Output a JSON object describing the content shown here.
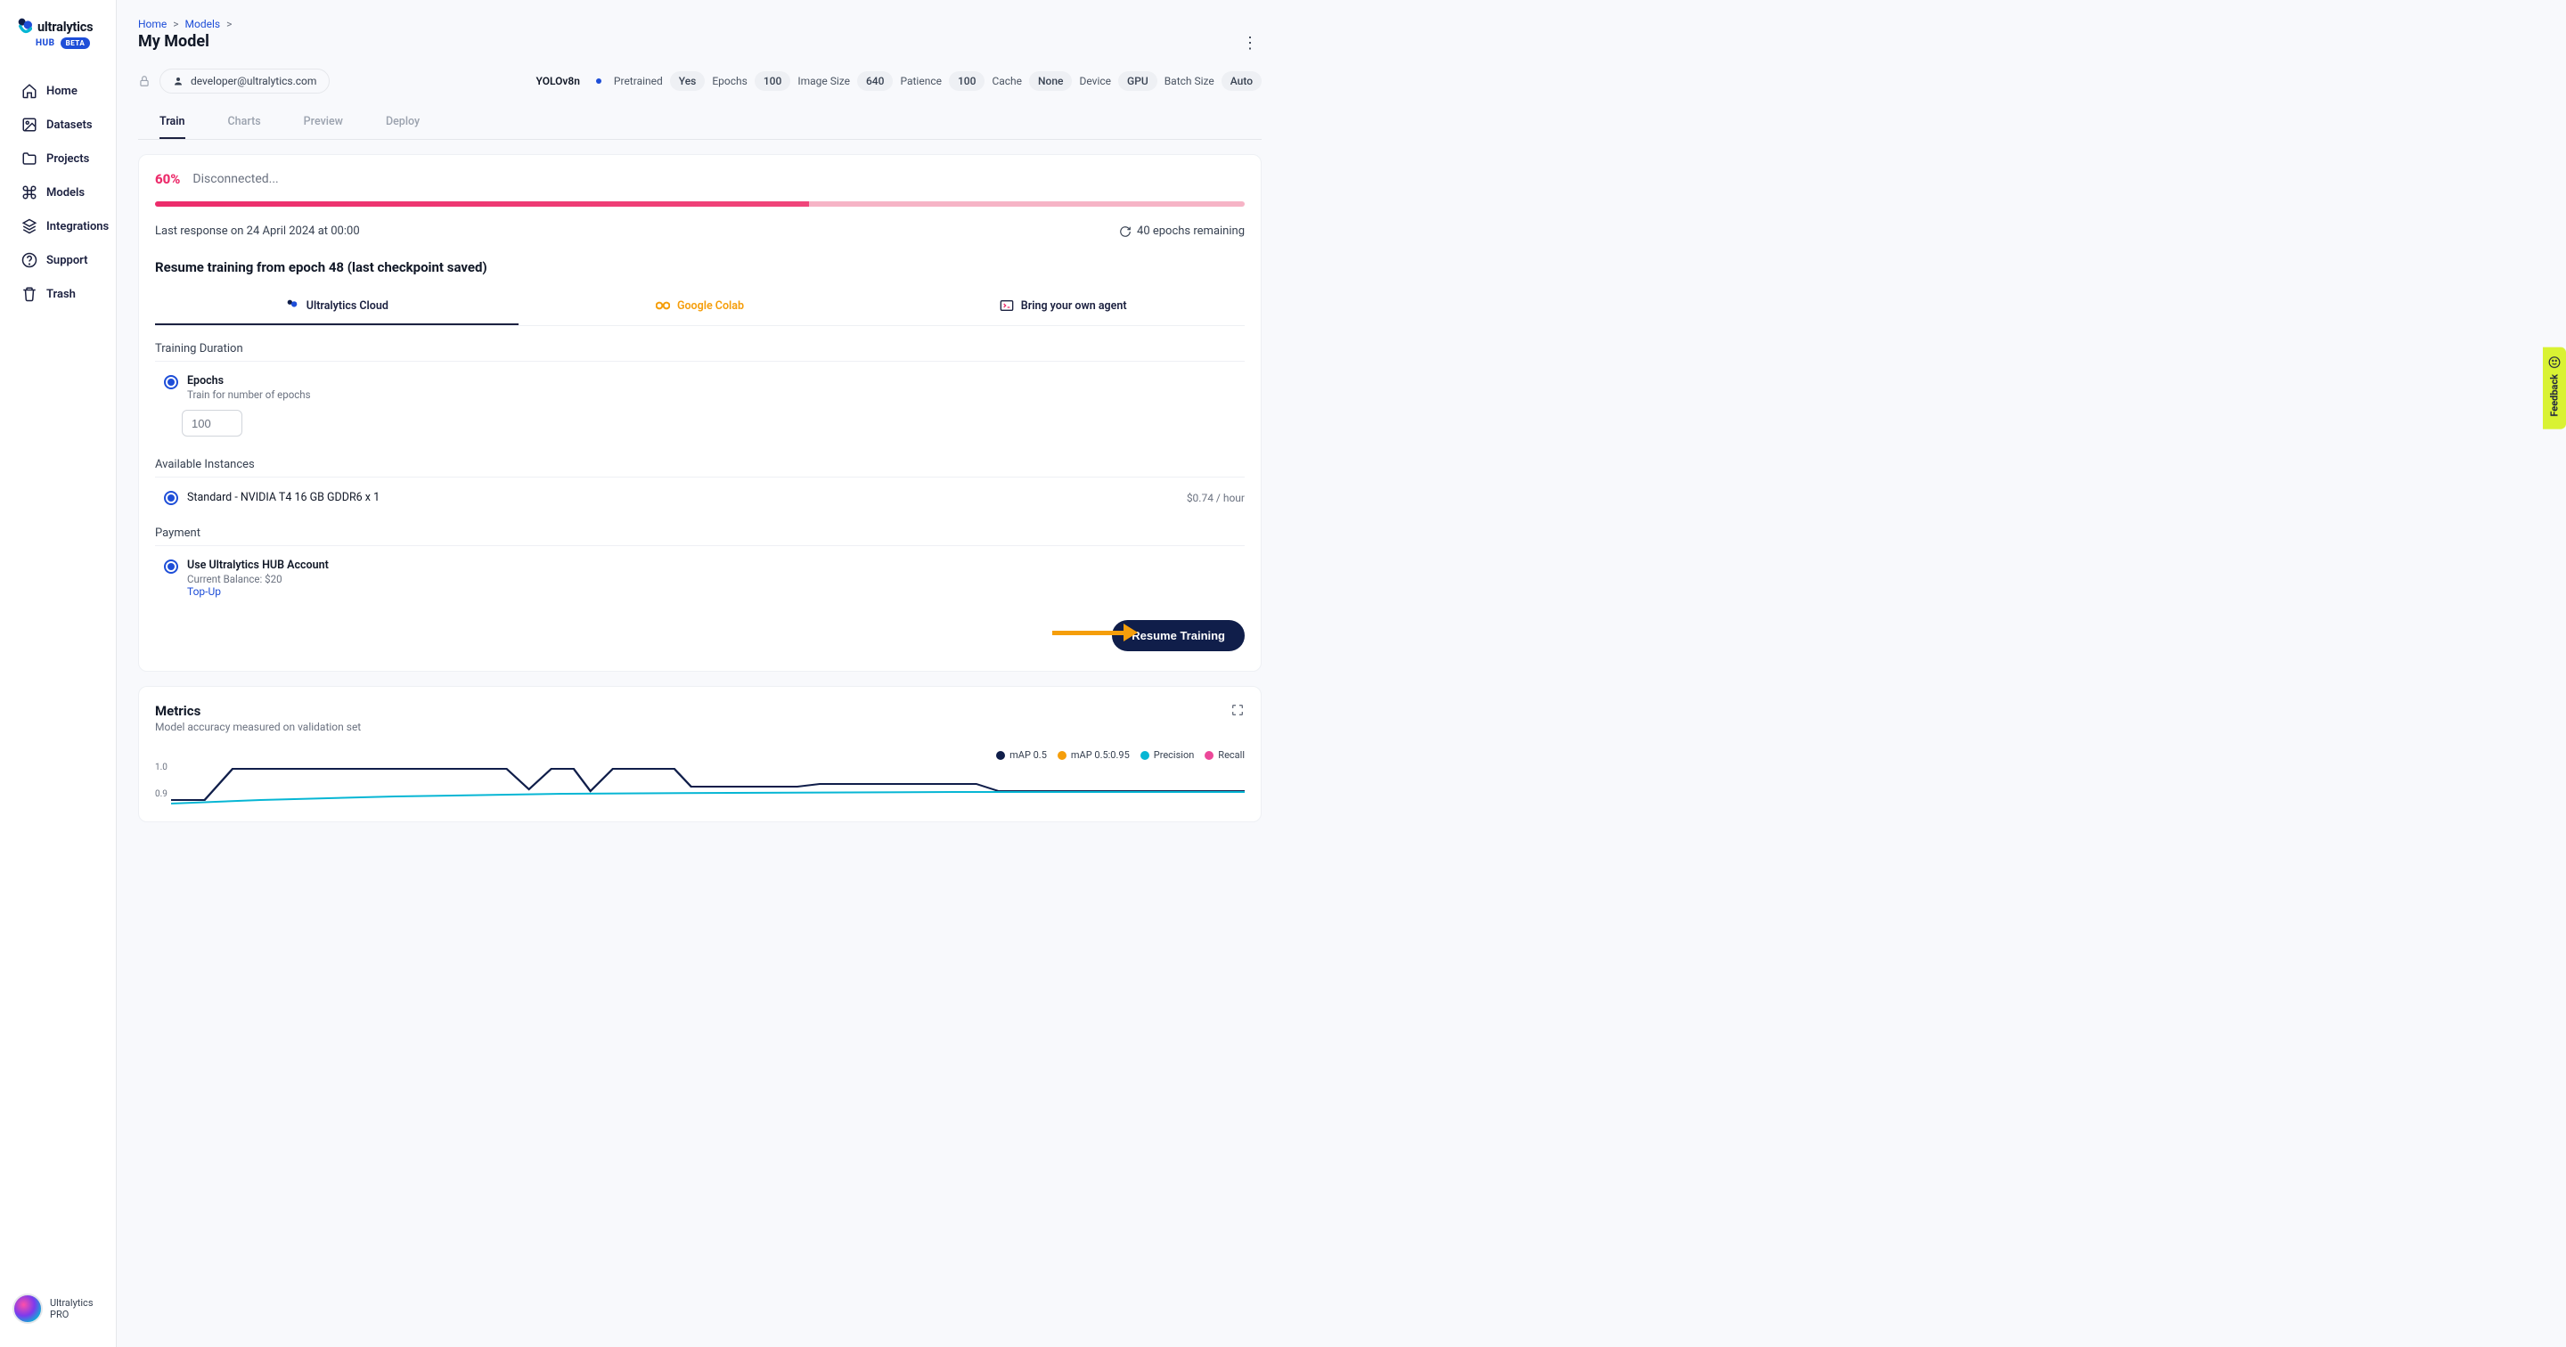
{
  "logo": {
    "brand": "ultralytics",
    "hub": "HUB",
    "beta": "BETA"
  },
  "sidebar": {
    "items": [
      {
        "label": "Home"
      },
      {
        "label": "Datasets"
      },
      {
        "label": "Projects"
      },
      {
        "label": "Models"
      },
      {
        "label": "Integrations"
      },
      {
        "label": "Support"
      },
      {
        "label": "Trash"
      }
    ],
    "user": {
      "name": "Ultralytics",
      "plan": "PRO"
    }
  },
  "breadcrumbs": {
    "home": "Home",
    "models": "Models"
  },
  "page_title": "My Model",
  "owner_email": "developer@ultralytics.com",
  "model_meta": {
    "model": "YOLOv8n",
    "pretrained_label": "Pretrained",
    "pretrained_val": "Yes",
    "epochs_label": "Epochs",
    "epochs_val": "100",
    "imgsz_label": "Image Size",
    "imgsz_val": "640",
    "patience_label": "Patience",
    "patience_val": "100",
    "cache_label": "Cache",
    "cache_val": "None",
    "device_label": "Device",
    "device_val": "GPU",
    "batch_label": "Batch Size",
    "batch_val": "Auto"
  },
  "tabs": {
    "train": "Train",
    "charts": "Charts",
    "preview": "Preview",
    "deploy": "Deploy"
  },
  "status": {
    "percent": "60%",
    "text": "Disconnected...",
    "last_response": "Last response on 24 April 2024 at 00:00",
    "remaining": "40 epochs remaining",
    "progress_pct": 60
  },
  "resume_heading": "Resume training from epoch 48 (last checkpoint saved)",
  "env_tabs": {
    "cloud": "Ultralytics Cloud",
    "colab": "Google Colab",
    "agent": "Bring your own agent"
  },
  "training": {
    "section": "Training Duration",
    "epochs_title": "Epochs",
    "epochs_sub": "Train for number of epochs",
    "epochs_value": "100"
  },
  "instances": {
    "section": "Available Instances",
    "name": "Standard - NVIDIA T4 16 GB GDDR6 x 1",
    "price": "$0.74 / hour"
  },
  "payment": {
    "section": "Payment",
    "title": "Use Ultralytics HUB Account",
    "balance": "Current Balance: $20",
    "topup": "Top-Up"
  },
  "resume_button": "Resume Training",
  "metrics": {
    "title": "Metrics",
    "sub": "Model accuracy measured on validation set",
    "legend": [
      {
        "label": "mAP 0.5",
        "color": "#101e4a"
      },
      {
        "label": "mAP 0.5:0.95",
        "color": "#f59e0b"
      },
      {
        "label": "Precision",
        "color": "#06b6d4"
      },
      {
        "label": "Recall",
        "color": "#ec4899"
      }
    ],
    "yticks": [
      "1.0",
      "0.9"
    ]
  },
  "feedback": "Feedback"
}
